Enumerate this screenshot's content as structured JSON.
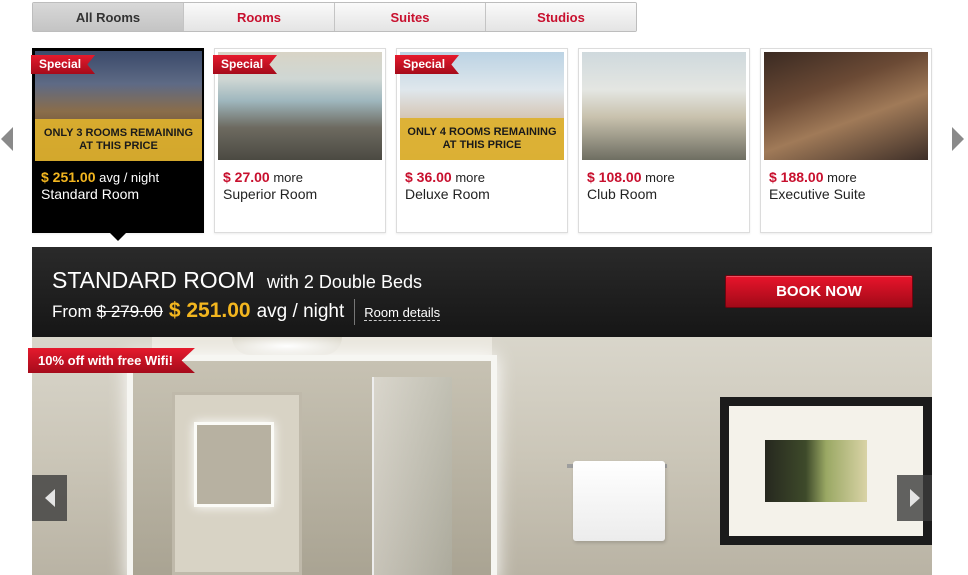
{
  "tabs": [
    {
      "label": "All Rooms",
      "active": true
    },
    {
      "label": "Rooms",
      "active": false
    },
    {
      "label": "Suites",
      "active": false
    },
    {
      "label": "Studios",
      "active": false
    }
  ],
  "cards": [
    {
      "price": "$ 251.00",
      "suffix": "avg / night",
      "name": "Standard Room",
      "special": "Special",
      "remaining": "ONLY 3 ROOMS REMAINING AT THIS PRICE",
      "selected": true
    },
    {
      "price": "$ 27.00",
      "suffix": "more",
      "name": "Superior Room",
      "special": "Special",
      "remaining": "",
      "selected": false
    },
    {
      "price": "$ 36.00",
      "suffix": "more",
      "name": "Deluxe Room",
      "special": "Special",
      "remaining": "ONLY 4 ROOMS REMAINING AT THIS PRICE",
      "selected": false
    },
    {
      "price": "$ 108.00",
      "suffix": "more",
      "name": "Club Room",
      "special": "",
      "remaining": "",
      "selected": false
    },
    {
      "price": "$ 188.00",
      "suffix": "more",
      "name": "Executive Suite",
      "special": "",
      "remaining": "",
      "selected": false
    }
  ],
  "detail": {
    "title": "STANDARD ROOM",
    "subtitle": "with 2 Double Beds",
    "from_label": "From",
    "old_price": "$ 279.00",
    "new_price": "$ 251.00",
    "per_night": "avg / night",
    "details_link": "Room details",
    "book_button": "BOOK NOW",
    "promo": "10% off with free Wifi!"
  },
  "icons": {
    "carousel_prev": "triangle-left-icon",
    "carousel_next": "triangle-right-icon",
    "hero_prev": "chevron-left-icon",
    "hero_next": "chevron-right-icon"
  },
  "colors": {
    "accent_red": "#c8102e",
    "price_gold": "#f3b61f",
    "banner_dark": "#1e1e1e"
  }
}
